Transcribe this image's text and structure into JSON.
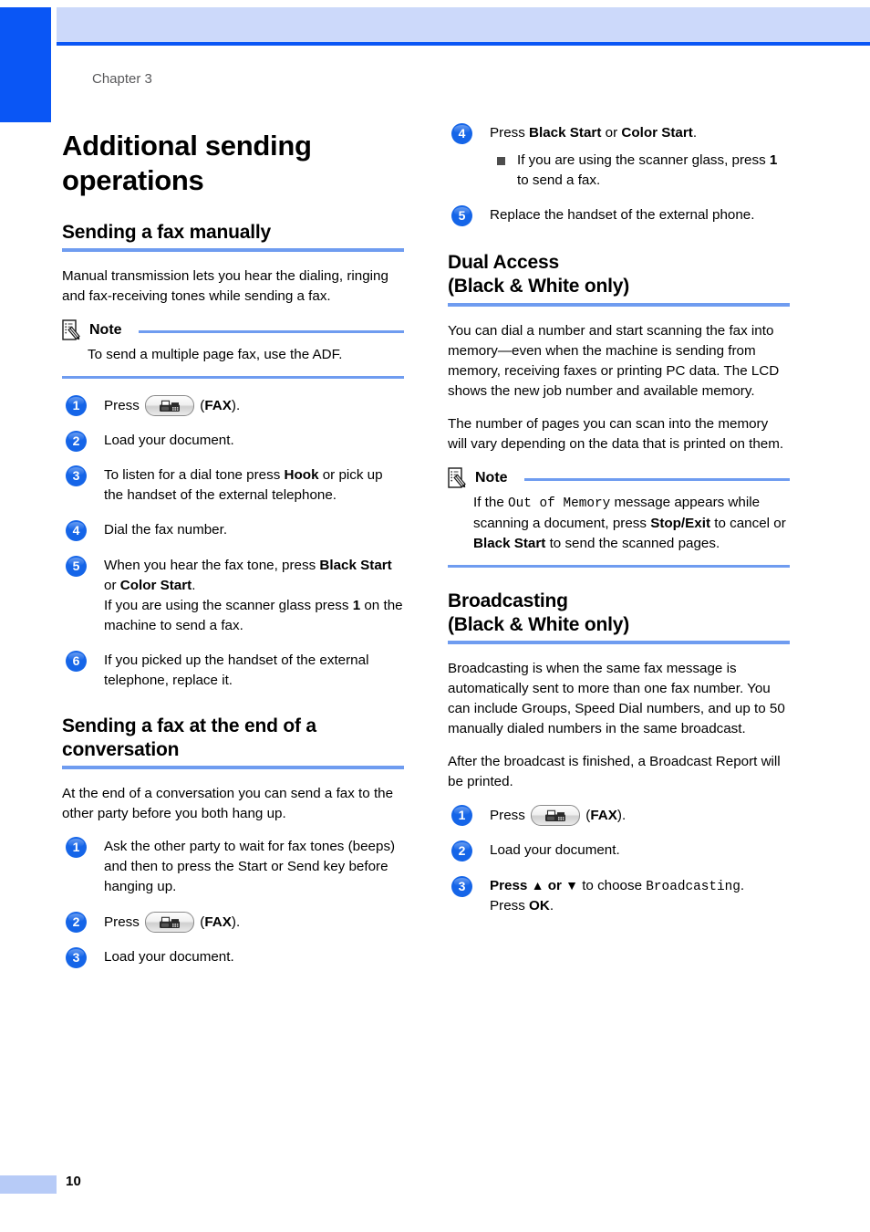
{
  "page": {
    "chapter_label": "Chapter 3",
    "page_number": "10",
    "title": "Additional sending operations",
    "accent_color": "#0a56f5",
    "rule_color": "#6f9cf0",
    "header_band_color": "#ccd9fa",
    "step_badge_color": "#1565e8"
  },
  "left_column": {
    "section1": {
      "heading": "Sending a fax manually",
      "intro": "Manual transmission lets you hear the dialing, ringing and fax-receiving tones while sending a fax.",
      "note": {
        "title": "Note",
        "icon": "note-pencil-icon",
        "body": "To send a multiple page fax, use the ADF."
      },
      "steps": [
        {
          "num": "1",
          "pre": "Press",
          "key_icon": "fax-key-icon",
          "post_open": "(",
          "key_label": "FAX",
          "post_close": ")."
        },
        {
          "num": "2",
          "text": "Load your document."
        },
        {
          "num": "3",
          "t1": "To listen for a dial tone press ",
          "b1": "Hook",
          "t2": " or pick up the handset of the external telephone."
        },
        {
          "num": "4",
          "text": "Dial the fax number."
        },
        {
          "num": "5",
          "t1": "When you hear the fax tone, press ",
          "b1": "Black Start",
          "t2": " or ",
          "b2": "Color Start",
          "t3": ".",
          "line2_a": "If you are using the scanner glass press ",
          "line2_b": "1",
          "line2_c": " on the machine to send a fax."
        },
        {
          "num": "6",
          "text": "If you picked up the handset of the external telephone, replace it."
        }
      ]
    },
    "section2": {
      "heading": "Sending a fax at the end of a conversation",
      "intro": "At the end of a conversation you can send a fax to the other party before you both hang up.",
      "steps": [
        {
          "num": "1",
          "text": "Ask the other party to wait for fax tones (beeps) and then to press the Start or Send key before hanging up."
        },
        {
          "num": "2",
          "pre": "Press",
          "key_icon": "fax-key-icon",
          "post_open": "(",
          "key_label": "FAX",
          "post_close": ")."
        },
        {
          "num": "3",
          "text": "Load your document."
        }
      ]
    }
  },
  "right_column": {
    "continued_steps": [
      {
        "num": "4",
        "t1": "Press ",
        "b1": "Black Start",
        "t2": " or ",
        "b2": "Color Start",
        "t3": ".",
        "sub_a": "If you are using the scanner glass, press ",
        "sub_b": "1",
        "sub_c": " to send a fax."
      },
      {
        "num": "5",
        "text": "Replace the handset of the external phone."
      }
    ],
    "section3": {
      "heading_line1": "Dual Access",
      "heading_line2": "(Black & White only)",
      "para1": "You can dial a number and start scanning the fax into memory—even when the machine is sending from memory, receiving faxes or printing PC data. The LCD shows the new job number and available memory.",
      "para2": "The number of pages you can scan into the memory will vary depending on the data that is printed on them.",
      "note": {
        "title": "Note",
        "icon": "note-pencil-icon",
        "t1": "If the ",
        "mono1": "Out of Memory",
        "t2": " message appears while scanning a document, press ",
        "b1": "Stop/Exit",
        "t3": " to cancel or ",
        "b2": "Black Start",
        "t4": " to send the scanned pages."
      }
    },
    "section4": {
      "heading_line1": "Broadcasting",
      "heading_line2": "(Black & White only)",
      "para1": "Broadcasting is when the same fax message is automatically sent to more than one fax number. You can include Groups, Speed Dial numbers, and up to 50 manually dialed numbers in the same broadcast.",
      "para2": "After the broadcast is finished, a Broadcast Report will be printed.",
      "steps": [
        {
          "num": "1",
          "pre": "Press",
          "key_icon": "fax-key-icon",
          "post_open": "(",
          "key_label": "FAX",
          "post_close": ")."
        },
        {
          "num": "2",
          "text": "Load your document."
        },
        {
          "num": "3",
          "t1": "Press ",
          "up": "▲",
          "t2": " or ",
          "down": "▼",
          "t3": " to choose ",
          "mono1": "Broadcasting",
          "t4": ".",
          "line2_a": "Press ",
          "line2_b": "OK",
          "line2_c": "."
        }
      ]
    }
  }
}
